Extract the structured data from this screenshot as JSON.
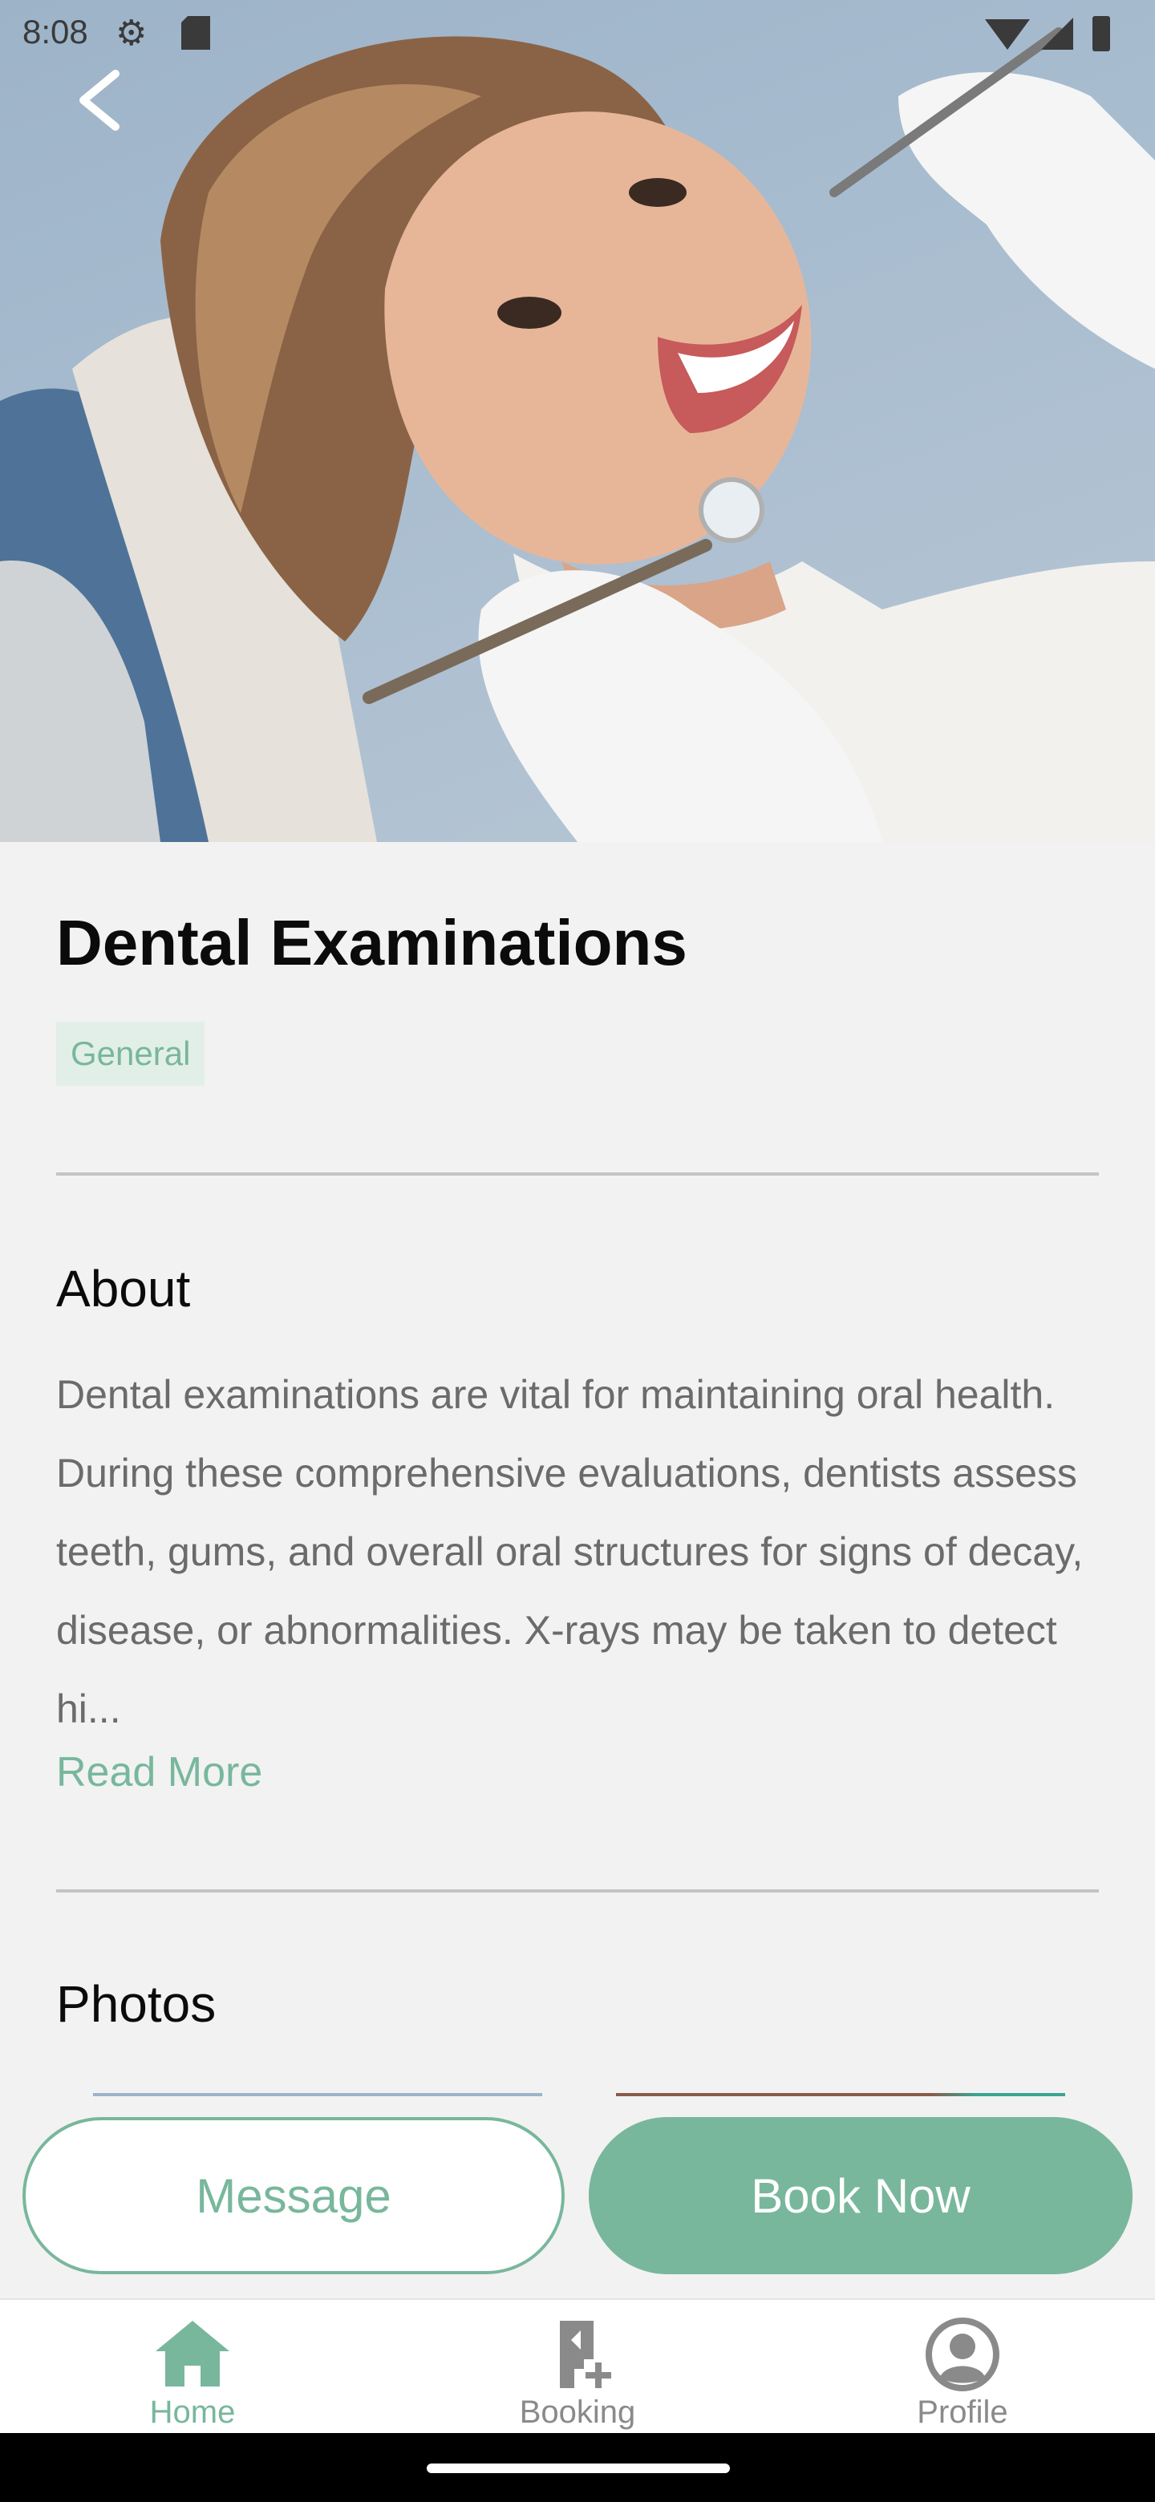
{
  "status_bar": {
    "time": "8:08"
  },
  "hero": {
    "image_alt": "dental-patient-photo"
  },
  "service": {
    "title": "Dental Examinations",
    "tag": "General"
  },
  "about": {
    "heading": "About",
    "text": "Dental examinations are vital for maintaining oral health. During these comprehensive evaluations, dentists assess teeth, gums, and overall oral structures for signs of decay, disease, or abnormalities. X-rays may be taken to detect hi...",
    "read_more": "Read More"
  },
  "photos": {
    "heading": "Photos"
  },
  "actions": {
    "message_label": "Message",
    "book_label": "Book Now"
  },
  "bottom_nav": {
    "items": [
      {
        "label": "Home",
        "icon": "home-icon",
        "active": true
      },
      {
        "label": "Booking",
        "icon": "booking-icon",
        "active": false
      },
      {
        "label": "Profile",
        "icon": "profile-icon",
        "active": false
      }
    ]
  },
  "colors": {
    "accent": "#78b79c",
    "text_dark": "#0b0b0b",
    "text_muted": "#6b6b6b",
    "nav_inactive": "#8a8a8a"
  }
}
